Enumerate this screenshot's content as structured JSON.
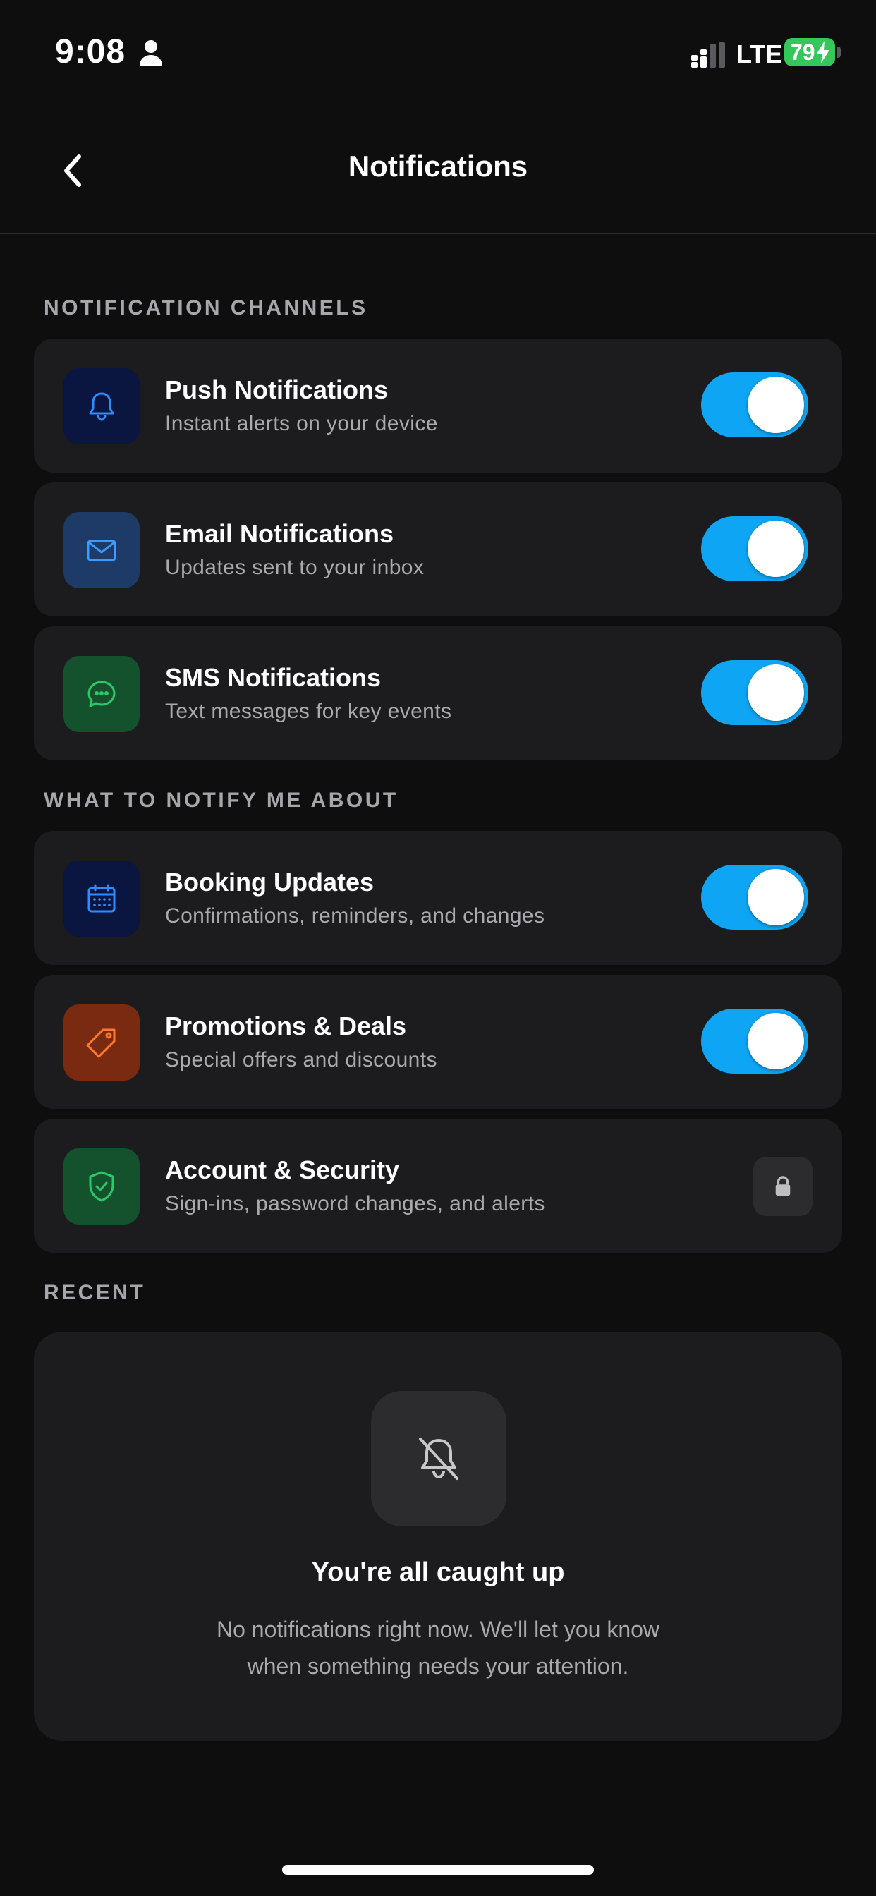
{
  "status_bar": {
    "time": "9:08",
    "network": "LTE",
    "battery": "79"
  },
  "nav": {
    "title": "Notifications"
  },
  "sections": {
    "channels": "NOTIFICATION CHANNELS",
    "topics": "WHAT TO NOTIFY ME ABOUT",
    "recent": "RECENT"
  },
  "channels": [
    {
      "title": "Push Notifications",
      "subtitle": "Instant alerts on your device",
      "icon": "bell-icon",
      "enabled": true
    },
    {
      "title": "Email Notifications",
      "subtitle": "Updates sent to your inbox",
      "icon": "mail-icon",
      "enabled": true
    },
    {
      "title": "SMS Notifications",
      "subtitle": "Text messages for key events",
      "icon": "chat-bubble-icon",
      "enabled": true
    }
  ],
  "topics": [
    {
      "title": "Booking Updates",
      "subtitle": "Confirmations, reminders, and changes",
      "icon": "calendar-icon",
      "enabled": true
    },
    {
      "title": "Promotions & Deals",
      "subtitle": "Special offers and discounts",
      "icon": "tag-icon",
      "enabled": true
    },
    {
      "title": "Account & Security",
      "subtitle": "Sign-ins, password changes, and alerts",
      "icon": "shield-check-icon",
      "locked": true
    }
  ],
  "recent": {
    "title": "You're all caught up",
    "message": "No notifications right now. We'll let you know when something needs your attention."
  },
  "colors": {
    "background": "#0e0e0f",
    "card": "#1c1c1e",
    "toggle_on": "#0ea5f5",
    "battery": "#34c759",
    "push_icon_bg": "#0a1540",
    "email_icon_bg": "#1e3a66",
    "sms_icon_bg": "#14522e",
    "booking_icon_bg": "#0a1540",
    "promo_icon_bg": "#7a2a10",
    "security_icon_bg": "#14522e"
  }
}
